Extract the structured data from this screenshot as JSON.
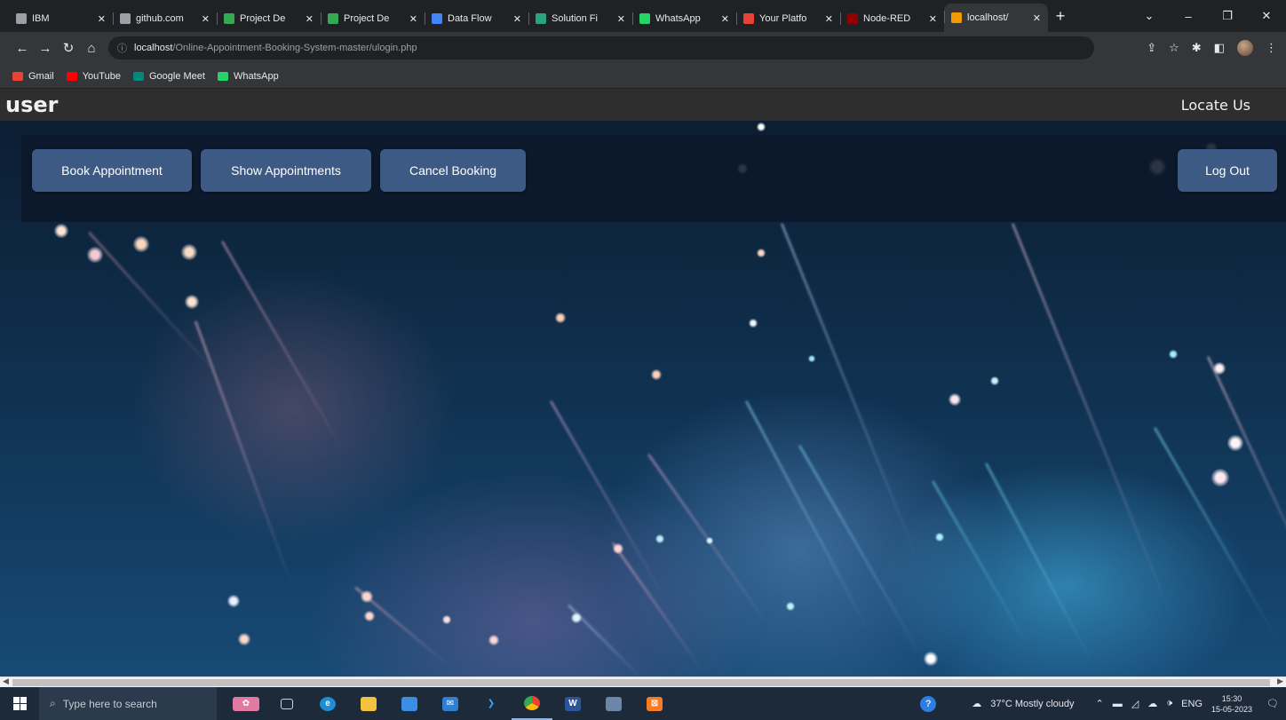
{
  "browser": {
    "tabs": [
      {
        "label": "IBM",
        "favicon": "globe-icon",
        "color": "#9aa0a6"
      },
      {
        "label": "github.com",
        "favicon": "globe-icon",
        "color": "#9aa0a6"
      },
      {
        "label": "Project De",
        "favicon": "drive-icon",
        "color": "#34a853"
      },
      {
        "label": "Project De",
        "favicon": "drive-icon",
        "color": "#34a853"
      },
      {
        "label": "Data Flow",
        "favicon": "docs-icon",
        "color": "#4285f4"
      },
      {
        "label": "Solution Fi",
        "favicon": "sheets-icon",
        "color": "#2ba27a"
      },
      {
        "label": "WhatsApp",
        "favicon": "whatsapp-icon",
        "color": "#25d366"
      },
      {
        "label": "Your Platfo",
        "favicon": "gmail-icon",
        "color": "#ea4335"
      },
      {
        "label": "Node-RED",
        "favicon": "node-red-icon",
        "color": "#8f0000"
      },
      {
        "label": "localhost/",
        "favicon": "page-icon",
        "color": "#f29900"
      }
    ],
    "active_tab_index": 9,
    "url_host": "localhost",
    "url_path": "/Online-Appointment-Booking-System-master/ulogin.php",
    "bookmarks": [
      {
        "label": "Gmail",
        "icon": "gmail-icon",
        "color": "#ea4335"
      },
      {
        "label": "YouTube",
        "icon": "youtube-icon",
        "color": "#ff0000"
      },
      {
        "label": "Google Meet",
        "icon": "meet-icon",
        "color": "#00897b"
      },
      {
        "label": "WhatsApp",
        "icon": "whatsapp-icon",
        "color": "#25d366"
      }
    ]
  },
  "site": {
    "brand": "user",
    "locate_link": "Locate Us",
    "nav": {
      "book": "Book Appointment",
      "show": "Show Appointments",
      "cancel": "Cancel Booking",
      "logout": "Log Out"
    },
    "accent_color": "#3d5a85"
  },
  "taskbar": {
    "search_placeholder": "Type here to search",
    "weather": "37°C  Mostly cloudy",
    "language": "ENG",
    "time": "15:30",
    "date": "15-05-2023"
  }
}
